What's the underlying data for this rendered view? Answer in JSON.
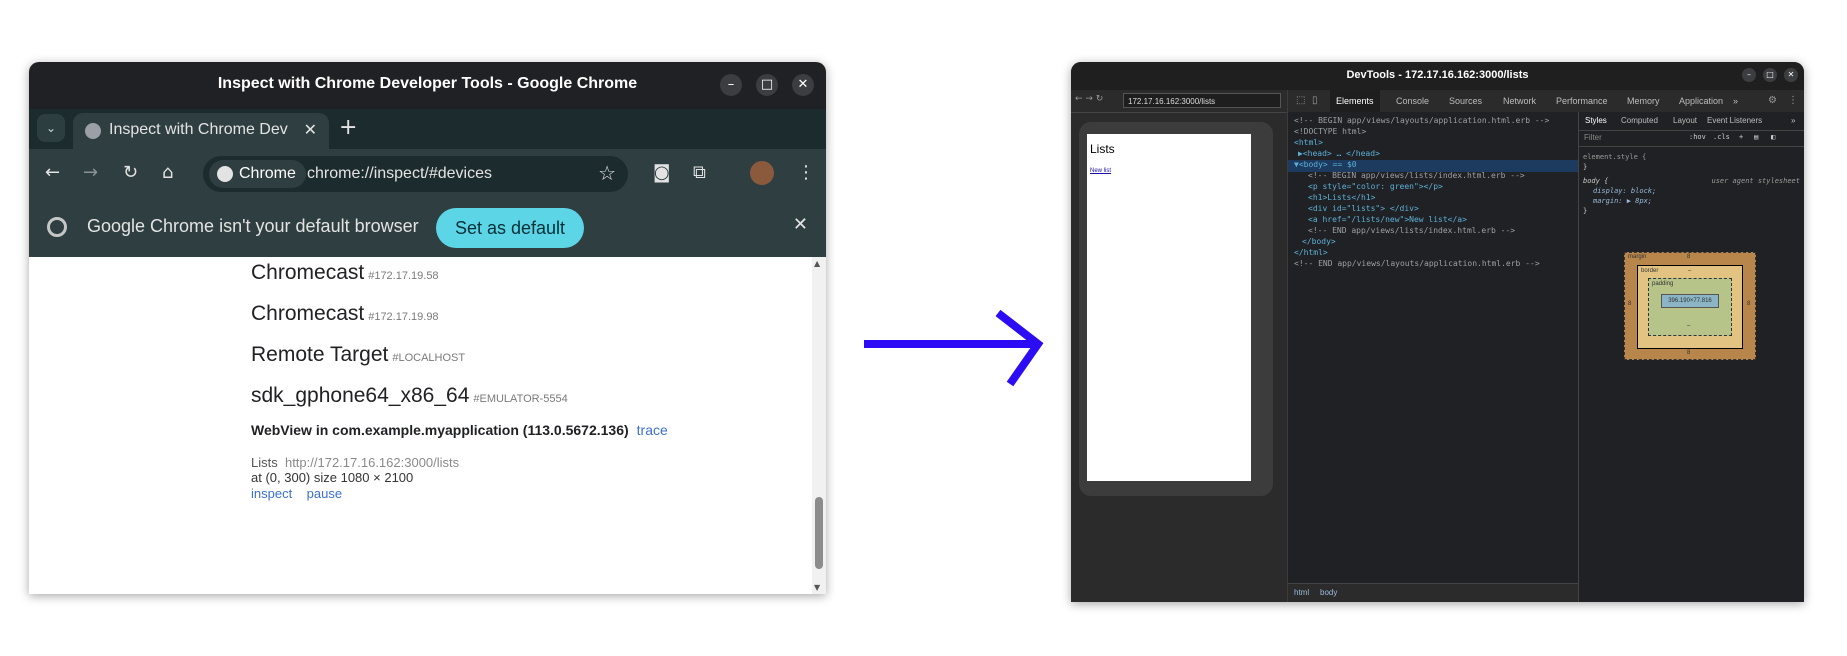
{
  "left_window": {
    "title": "Inspect with Chrome Developer Tools - Google Chrome",
    "tab_label": "Inspect with Chrome Dev",
    "omnibox_chip": "Chrome",
    "url": "chrome://inspect/#devices",
    "infobar_text": "Google Chrome isn't your default browser",
    "set_default_label": "Set as default",
    "devices": [
      {
        "name": "Chromecast",
        "id": "#172.17.19.58"
      },
      {
        "name": "Chromecast",
        "id": "#172.17.19.98"
      },
      {
        "name": "Remote Target",
        "id": "#LOCALHOST"
      },
      {
        "name": "sdk_gphone64_x86_64",
        "id": "#EMULATOR-5554"
      }
    ],
    "webview_label": "WebView in com.example.myapplication (113.0.5672.136)",
    "trace_label": "trace",
    "page_title": "Lists",
    "page_url": "http://172.17.16.162:3000/lists",
    "page_position": "at (0, 300)  size 1080 × 2100",
    "inspect_label": "inspect",
    "pause_label": "pause"
  },
  "arrow_color": "#2c0cf5",
  "right_window": {
    "title": "DevTools - 172.17.16.162:3000/lists",
    "url": "172.17.16.162:3000/lists",
    "screen_heading": "Lists",
    "screen_link": "New list",
    "tabs": [
      "Elements",
      "Console",
      "Sources",
      "Network",
      "Performance",
      "Memory",
      "Application"
    ],
    "more_tabs": "»",
    "elements_lines": [
      "<!-- BEGIN app/views/layouts/application.html.erb -->",
      "<!DOCTYPE html>",
      "<html>",
      "▶<head> … </head>",
      "▼<body> == $0",
      "<!-- BEGIN app/views/lists/index.html.erb -->",
      "<p style=\"color: green\"></p>",
      "<h1>Lists</h1>",
      "<div id=\"lists\"> </div>",
      "<a href=\"/lists/new\">New list</a>",
      "<!-- END app/views/lists/index.html.erb -->",
      "</body>",
      "</html>",
      "<!-- END app/views/layouts/application.html.erb -->"
    ],
    "breadcrumbs": [
      "html",
      "body"
    ],
    "styles_tabs": [
      "Styles",
      "Computed",
      "Layout",
      "Event Listeners"
    ],
    "filter_placeholder": "Filter",
    "filter_hov": ":hov",
    "filter_cls": ".cls",
    "element_style": "element.style {",
    "close_brace": "}",
    "body_rule": "body {",
    "ua_label": "user agent stylesheet",
    "decl_display": "display: block;",
    "decl_margin": "margin: ▶ 8px;",
    "box_margin_label": "margin",
    "box_margin_value": "8",
    "box_border_label": "border",
    "box_border_value": "–",
    "box_padding_label": "padding",
    "box_padding_value": "–",
    "box_content": "396.190×77.816"
  }
}
